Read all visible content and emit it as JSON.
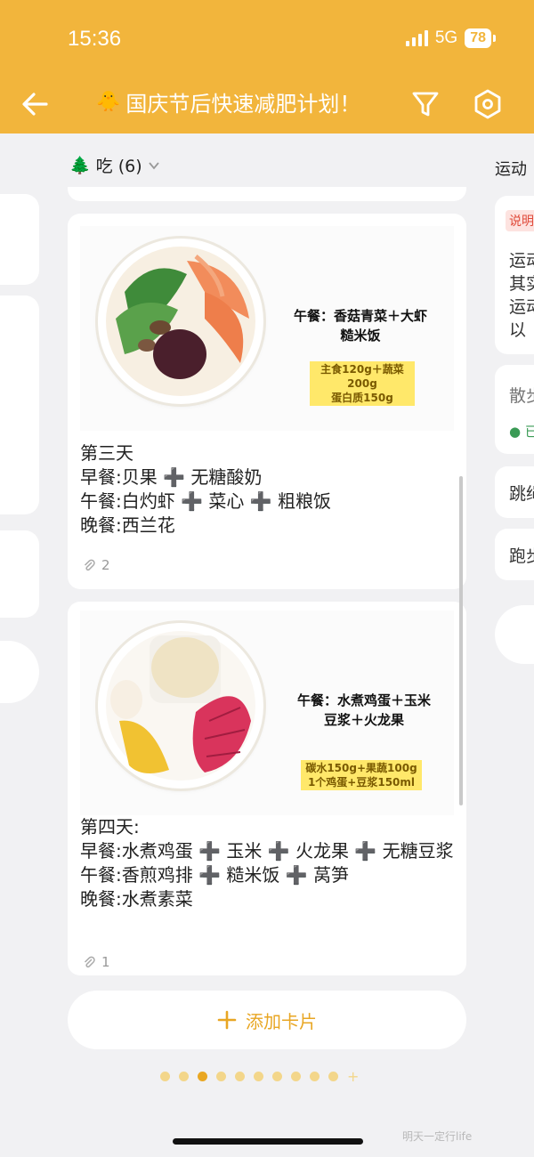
{
  "status_bar": {
    "time": "15:36",
    "network": "5G",
    "battery": "78"
  },
  "header": {
    "title_emoji": "🐥",
    "title": "国庆节后快速减肥计划！"
  },
  "columns": {
    "eat": {
      "emoji": "🌲",
      "label": "吃 (6)"
    },
    "exercise": {
      "label": "运动"
    }
  },
  "cards": [
    {
      "image_caption": "午餐：香菇青菜＋大虾\n糙米饭",
      "image_note": "主食120g＋蔬菜200g\n蛋白质150g",
      "text": "第三天\n早餐:贝果 ➕ 无糖酸奶\n午餐:白灼虾 ➕ 菜心 ➕ 粗粮饭\n晚餐:西兰花",
      "attachments": "2"
    },
    {
      "image_caption": "午餐：水煮鸡蛋＋玉米\n豆浆＋火龙果",
      "image_note": "碳水150g+果蔬100g\n1个鸡蛋+豆浆150ml",
      "text": "第四天:\n早餐:水煮鸡蛋 ➕ 玉米 ➕ 火龙果 ➕ 无糖豆浆\n午餐:香煎鸡排 ➕ 糙米饭 ➕ 莴笋\n晚餐:水煮素菜",
      "attachments": "1"
    }
  ],
  "right_column": {
    "badge": "说明",
    "note_lines": [
      "运动",
      "其实",
      "运动",
      "以"
    ],
    "item1": "散步",
    "item1_status": "已",
    "item2": "跳绳",
    "item3": "跑步"
  },
  "add_card": {
    "label": "添加卡片"
  },
  "pagination": {
    "total": 10,
    "active_index": 2
  },
  "watermark": "明天一定行life",
  "colors": {
    "brand": "#f2b53c",
    "accent": "#e8a623",
    "background": "#f1f1f3"
  }
}
